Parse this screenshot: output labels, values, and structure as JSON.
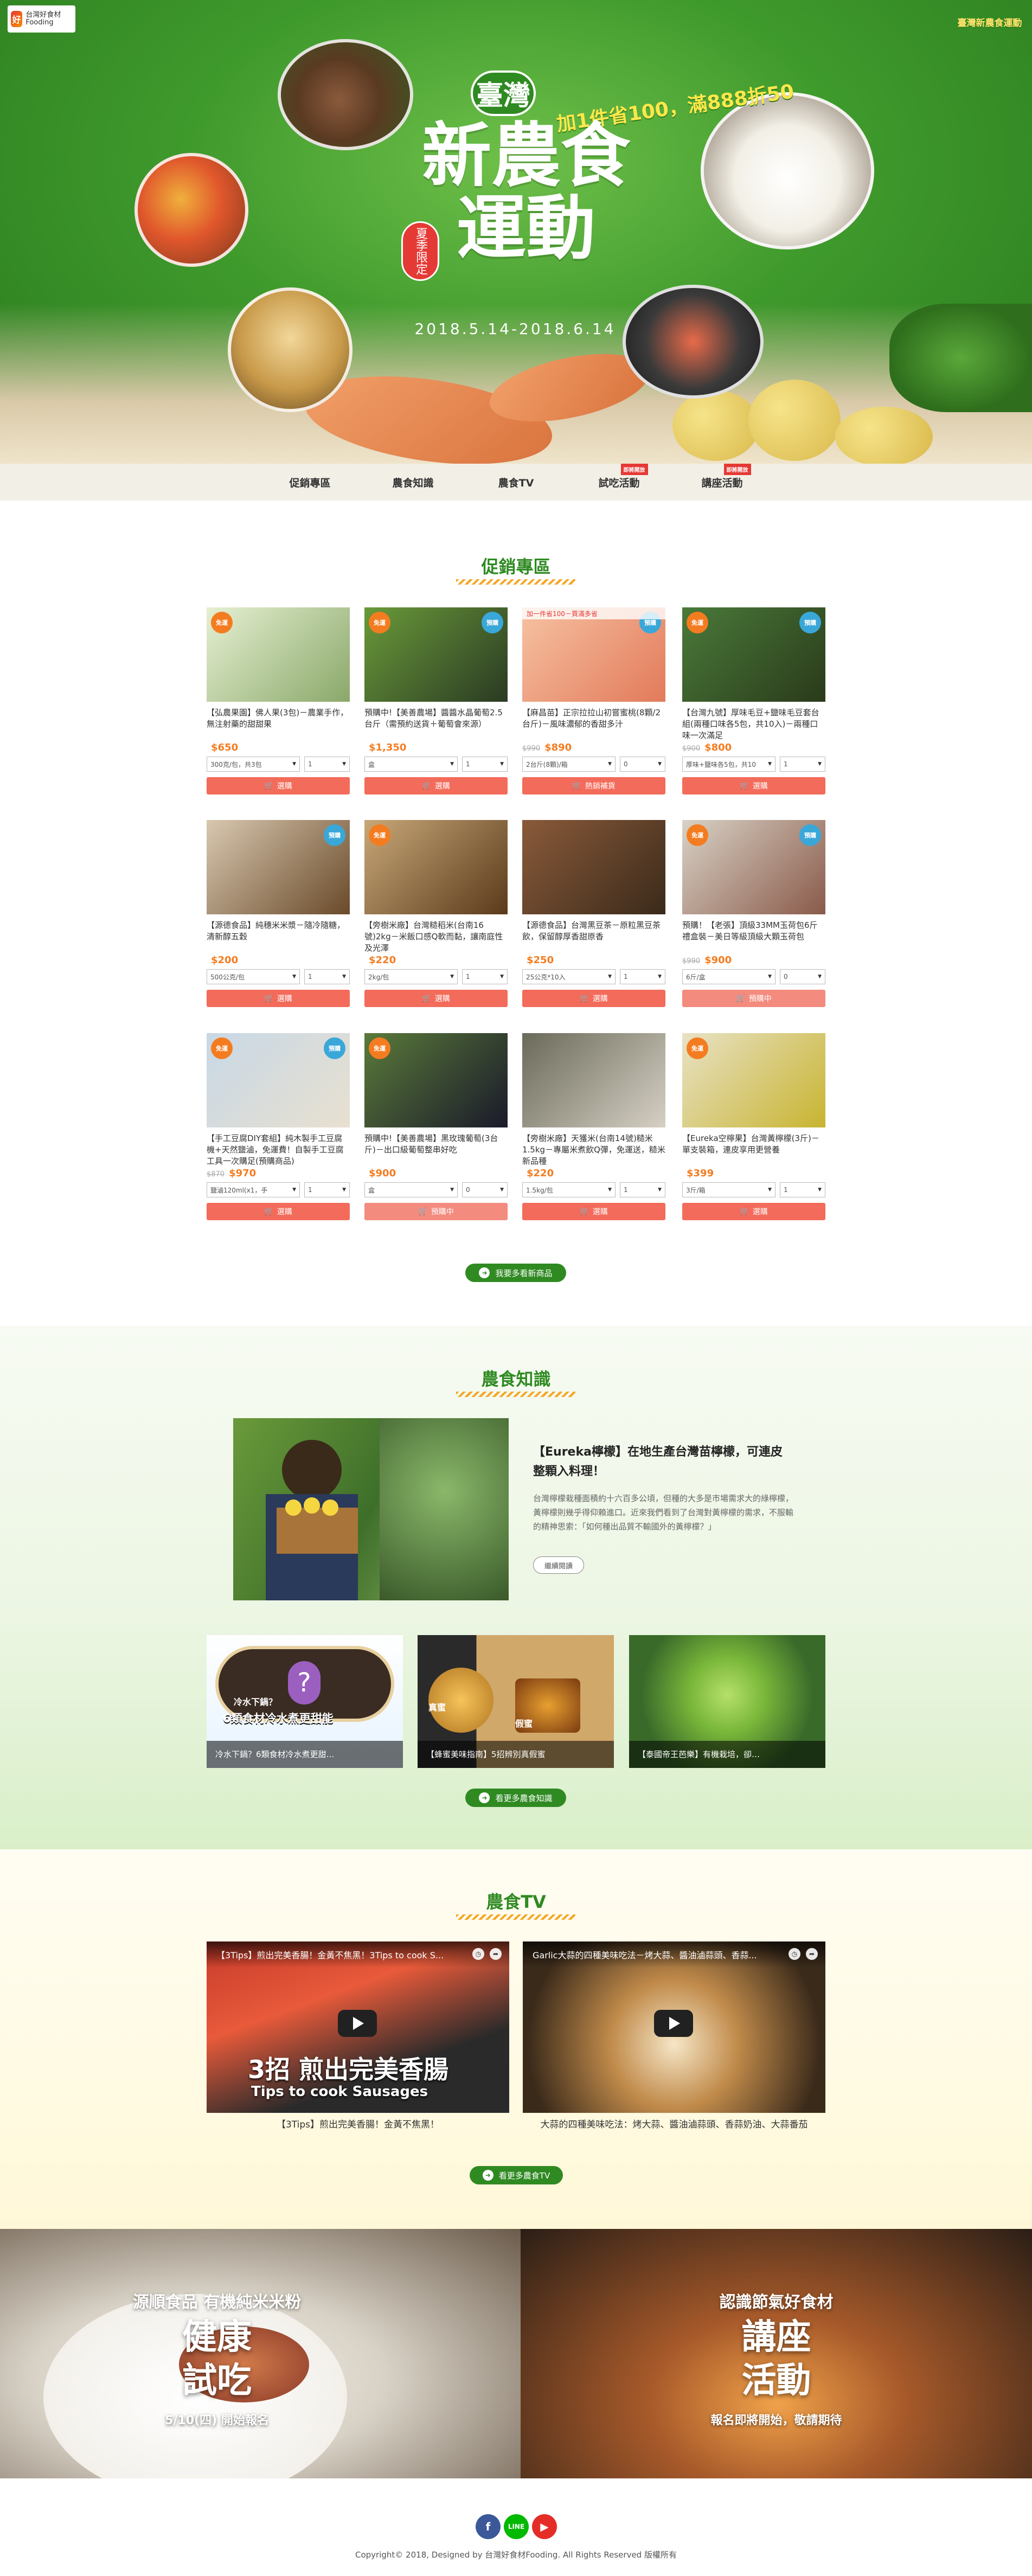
{
  "header": {
    "logo_left_text": "台灣好食材 Fooding",
    "logo_right_text": "臺灣新農食運動"
  },
  "hero": {
    "taiwan": "臺灣",
    "title_line1": "新農食",
    "title_line2": "運動",
    "promo": "加1件省100，滿888折50",
    "seal": "夏季限定",
    "date": "2018.5.14-2018.6.14"
  },
  "nav": {
    "items": [
      {
        "label": "促銷專區",
        "tag": ""
      },
      {
        "label": "農食知識",
        "tag": ""
      },
      {
        "label": "農食TV",
        "tag": ""
      },
      {
        "label": "試吃活動",
        "tag": "即將開放"
      },
      {
        "label": "講座活動",
        "tag": "即將開放"
      }
    ]
  },
  "promo_section": {
    "title": "促銷專區",
    "more": "我要多看新商品",
    "products": [
      {
        "name": "【弘農果園】佛人果(3包)－農業手作，無注射藥的甜甜果",
        "old": "",
        "price": "$650",
        "opt1": "300克/包，共3包",
        "opt2": "1",
        "button": "選購",
        "badge1": "免運",
        "badge2": ""
      },
      {
        "name": "預購中!【美善農場】醬醬水晶葡萄2.5台斤（需預約送貨＋葡萄會來源）",
        "old": "",
        "price": "$1,350",
        "opt1": "盒",
        "opt2": "1",
        "button": "選購",
        "badge1": "免運",
        "badge2": "預購"
      },
      {
        "name": "【麻昌苗】正宗拉拉山初嘗蜜桃(8顆/2台斤)－風味濃郁的香甜多汁",
        "old": "$990",
        "price": "$890",
        "opt1": "2台斤(8顆)/箱",
        "opt2": "0",
        "button": "熱銷補貨",
        "badge1": "",
        "badge2": "預購",
        "ribbon": "加一件省100－買滿多省"
      },
      {
        "name": "【台灣九號】厚味毛豆+鹽味毛豆套台組(兩種口味各5包，共10入)－兩種口味一次滿足",
        "old": "$900",
        "price": "$800",
        "opt1": "厚味+鹽味各5包，共10",
        "opt2": "1",
        "button": "選購",
        "badge1": "免運",
        "badge2": "預購"
      },
      {
        "name": "【源德食品】純穗米米漿－隨冷隨糖，清新醇五穀",
        "old": "",
        "price": "$200",
        "opt1": "500公克/包",
        "opt2": "1",
        "button": "選購",
        "badge1": "",
        "badge2": "預購"
      },
      {
        "name": "【旁樹米廠】台灣糙稻米(台南16號)2kg－米飯口感Q軟而黏，讓南庭性及光澤",
        "old": "",
        "price": "$220",
        "opt1": "2kg/包",
        "opt2": "1",
        "button": "選購",
        "badge1": "免運",
        "badge2": ""
      },
      {
        "name": "【源德食品】台灣黑豆茶－原粒黑豆茶飲，保留醇厚香甜原香",
        "old": "",
        "price": "$250",
        "opt1": "25公克*10入",
        "opt2": "1",
        "button": "選購",
        "badge1": "",
        "badge2": ""
      },
      {
        "name": "預購！【老張】頂級33MM玉荷包6斤禮盒裝－美日等級頂級大顆玉荷包",
        "old": "$990",
        "price": "$900",
        "opt1": "6斤/盒",
        "opt2": "0",
        "button": "預購中",
        "badge1": "免運",
        "badge2": "預購"
      },
      {
        "name": "【手工豆腐DIY套組】純木製手工豆腐機+天然鹽滷，免運費！自製手工豆腐工具一次購足(預購商品)",
        "old": "$870",
        "price": "$970",
        "opt1": "鹽滷120ml(x1，手",
        "opt2": "1",
        "button": "選購",
        "badge1": "免運",
        "badge2": "預購"
      },
      {
        "name": "預購中!【美善農場】黑玫瑰葡萄(3台斤)－出口級葡萄整串好吃",
        "old": "",
        "price": "$900",
        "opt1": "盒",
        "opt2": "0",
        "button": "預購中",
        "badge1": "免運",
        "badge2": ""
      },
      {
        "name": "【旁樹米廠】天獲米(台南14號)糙米1.5kg－專屬米煮飲Q彈，免運送，糙米新品種",
        "old": "",
        "price": "$220",
        "opt1": "1.5kg/包",
        "opt2": "1",
        "button": "選購",
        "badge1": "",
        "badge2": ""
      },
      {
        "name": "【Eureka空檸果】台灣黃檸檬(3斤)－單支裝箱，連皮享用更營養",
        "old": "",
        "price": "$399",
        "opt1": "3斤/箱",
        "opt2": "1",
        "button": "選購",
        "badge1": "免運",
        "badge2": ""
      }
    ]
  },
  "knowledge": {
    "title": "農食知識",
    "main_title": "【Eureka檸檬】在地生產台灣苗檸檬，可連皮整顆入料理！",
    "main_desc": "台灣檸檬栽種面積約十六百多公頃，但種的大多是市場需求大的綠檸檬，黃檸檬則幾乎得仰賴進口。近來我們看到了台灣對黃檸檬的需求，不服輸的精神思索：「如何種出品質不輸國外的黃檸檬？」",
    "read_more": "繼續閱讀",
    "thumbs": [
      {
        "caption": "冷水下鍋？6類食材冷水煮更甜…",
        "label_top": "冷水下鍋？",
        "label_main": "6類食材冷水煮更甜能"
      },
      {
        "caption": "【蜂蜜美味指南】5招辨別真假蜜",
        "label_a": "真蜜",
        "label_b": "假蜜"
      },
      {
        "caption": "【泰國帝王芭樂】有機栽培，卻…"
      }
    ],
    "more": "看更多農食知識"
  },
  "tv": {
    "title": "農食TV",
    "videos": [
      {
        "title": "【3Tips】煎出完美香腸！金黃不焦黑！3Tips to cook S...",
        "caption": "【3Tips】煎出完美香腸！金黃不焦黑！",
        "overlay_big": "3招 煎出完美香腸",
        "overlay_small": "Tips to cook Sausages"
      },
      {
        "title": "Garlic大蒜的四種美味吃法－烤大蒜、醬油滷蒜頭、香蒜...",
        "caption": "大蒜的四種美味吃法：烤大蒜、醬油滷蒜頭、香蒜奶油、大蒜番茄"
      }
    ],
    "more": "看更多農食TV"
  },
  "events": [
    {
      "sub": "源順食品 有機純米米粉",
      "big1": "健康",
      "big2": "試吃",
      "foot": "5/10(四) 開始報名"
    },
    {
      "sub": "認識節氣好食材",
      "big1": "講座",
      "big2": "活動",
      "foot": "報名即將開始，敬請期待"
    }
  ],
  "footer": {
    "copyright": "Copyright© 2018, Designed by 台灣好食材Fooding. All Rights Reserved 版權所有",
    "social": [
      "facebook-icon",
      "line-icon",
      "youtube-icon"
    ]
  },
  "colors": {
    "brand_green": "#2f8a22",
    "accent_orange": "#f47c20",
    "button_red": "#f36b5a"
  }
}
